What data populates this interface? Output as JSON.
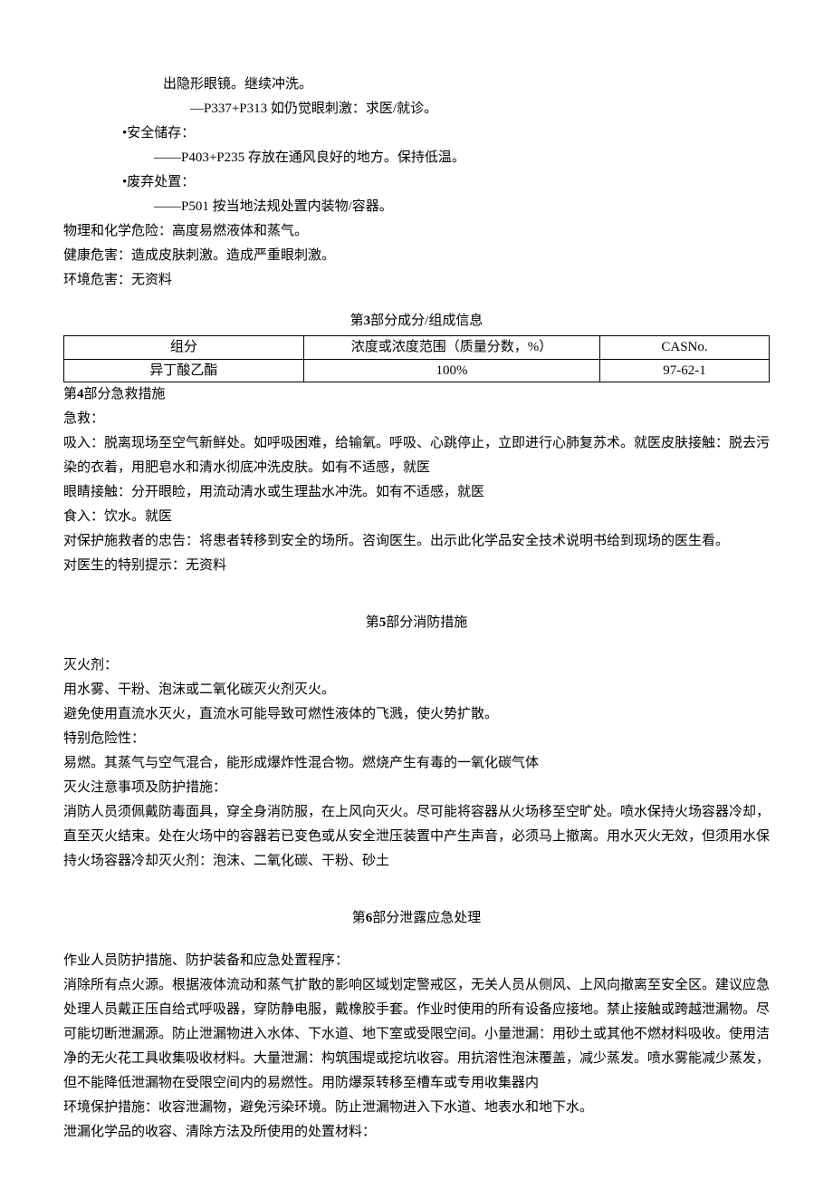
{
  "precaution": {
    "l1": "出隐形眼镜。继续冲洗。",
    "l2": "—P337+P313 如仍觉眼刺激：求医/就诊。",
    "storage_label": "•安全储存：",
    "storage_line": "——P403+P235 存放在通风良好的地方。保持低温。",
    "disposal_label": "•废弃处置：",
    "disposal_line": "——P501 按当地法规处置内装物/容器。"
  },
  "hazards": {
    "phys": "物理和化学危险：高度易燃液体和蒸气。",
    "health": "健康危害：造成皮肤刺激。造成严重眼刺激。",
    "env": "环境危害：无资料"
  },
  "section3": {
    "title_prefix": "第",
    "title_num": "3",
    "title_suffix": "部分成分/组成信息",
    "headers": {
      "c1": "组分",
      "c2": "浓度或浓度范围（质量分数，%）",
      "c3": "CASNo."
    },
    "row": {
      "c1": "异丁酸乙酯",
      "c2": "100%",
      "c3": "97-62-1"
    }
  },
  "section4": {
    "title_prefix": "第",
    "title_num": "4",
    "title_suffix": "部分急救措施",
    "l1": "急救：",
    "l2": "吸入：脱离现场至空气新鲜处。如呼吸困难，给输氧。呼吸、心跳停止，立即进行心肺复苏术。就医皮肤接触：脱去污染的衣着，用肥皂水和清水彻底冲洗皮肤。如有不适感，就医",
    "l3": "眼睛接触：分开眼睑，用流动清水或生理盐水冲洗。如有不适感，就医",
    "l4": "食入：饮水。就医",
    "l5": "对保护施救者的忠告：将患者转移到安全的场所。咨询医生。出示此化学品安全技术说明书给到现场的医生看。",
    "l6": "对医生的特别提示：无资料"
  },
  "section5": {
    "title_prefix": "第",
    "title_num": "5",
    "title_suffix": "部分消防措施",
    "l1": "灭火剂：",
    "l2": "用水雾、干粉、泡沫或二氧化碳灭火剂灭火。",
    "l3": "避免使用直流水灭火，直流水可能导致可燃性液体的飞溅，使火势扩散。",
    "l4": "特别危险性：",
    "l5": "易燃。其蒸气与空气混合，能形成爆炸性混合物。燃烧产生有毒的一氧化碳气体",
    "l6": "灭火注意事项及防护措施：",
    "l7": "消防人员须佩戴防毒面具，穿全身消防服，在上风向灭火。尽可能将容器从火场移至空旷处。喷水保持火场容器冷却，直至灭火结束。处在火场中的容器若已变色或从安全泄压装置中产生声音，必须马上撤离。用水灭火无效，但须用水保持火场容器冷却灭火剂：泡沫、二氧化碳、干粉、砂土"
  },
  "section6": {
    "title_prefix": "第",
    "title_num": "6",
    "title_suffix": "部分泄露应急处理",
    "l1": "作业人员防护措施、防护装备和应急处置程序：",
    "l2": "消除所有点火源。根据液体流动和蒸气扩散的影响区域划定警戒区，无关人员从侧风、上风向撤离至安全区。建议应急处理人员戴正压自给式呼吸器，穿防静电服，戴橡胶手套。作业时使用的所有设备应接地。禁止接触或跨越泄漏物。尽可能切断泄漏源。防止泄漏物进入水体、下水道、地下室或受限空间。小量泄漏：用砂土或其他不燃材料吸收。使用洁净的无火花工具收集吸收材料。大量泄漏：构筑围堤或挖坑收容。用抗溶性泡沫覆盖，减少蒸发。喷水雾能减少蒸发，但不能降低泄漏物在受限空间内的易燃性。用防爆泵转移至槽车或专用收集器内",
    "l3": "环境保护措施：收容泄漏物，避免污染环境。防止泄漏物进入下水道、地表水和地下水。",
    "l4": "泄漏化学品的收容、清除方法及所使用的处置材料："
  }
}
